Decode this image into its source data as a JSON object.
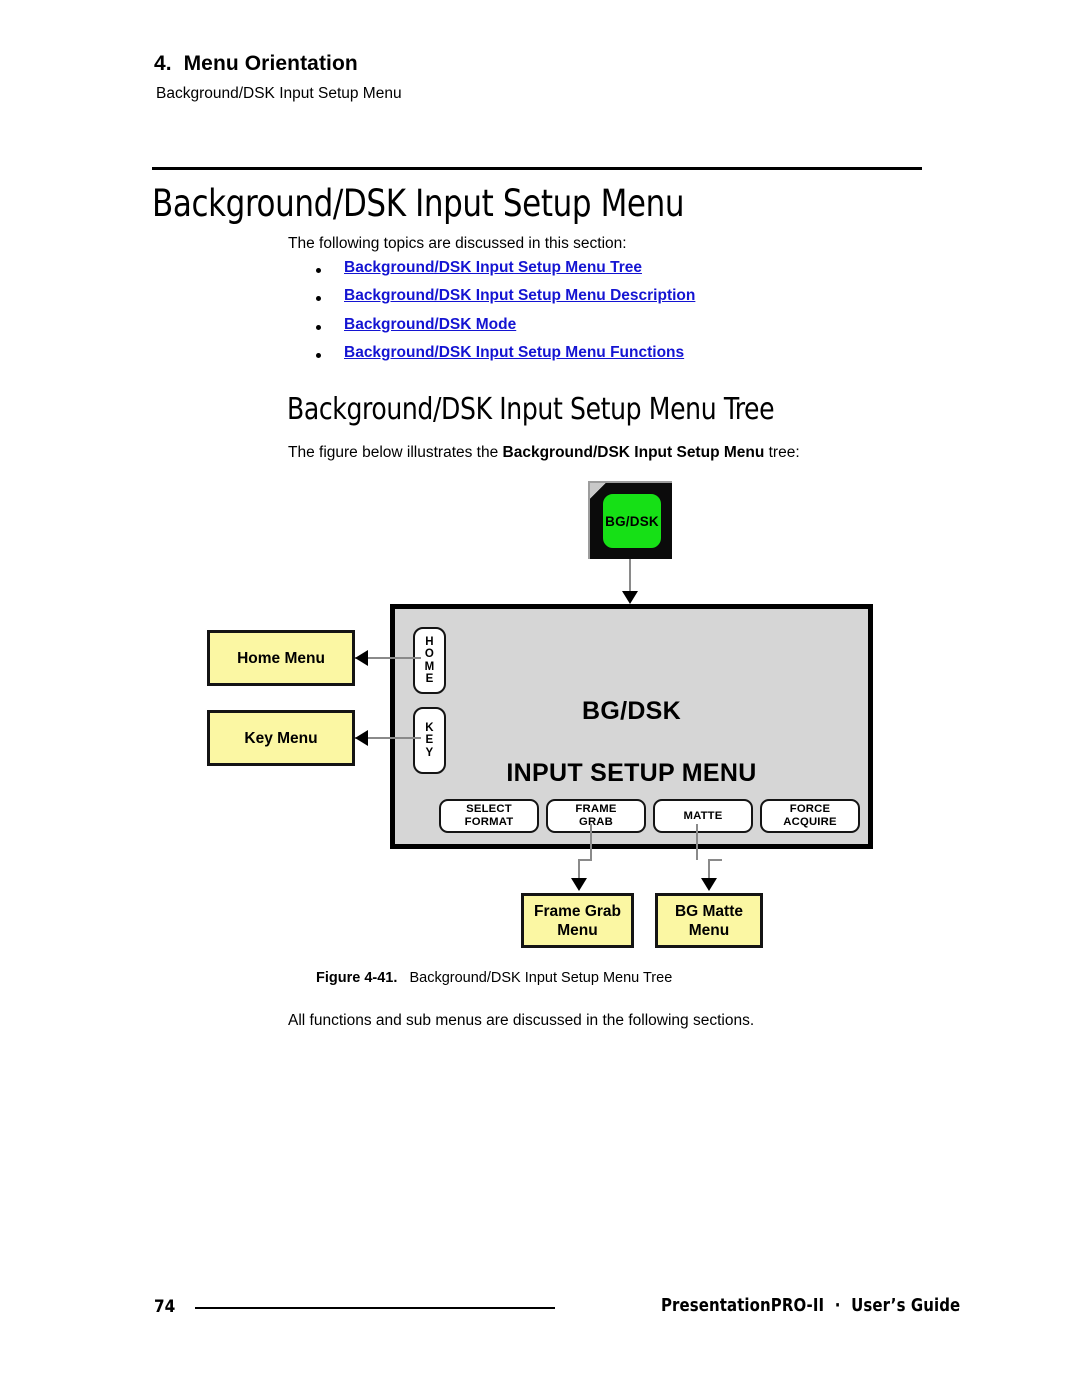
{
  "header": {
    "chapter": "4.  Menu Orientation",
    "subtitle": "Background/DSK Input Setup Menu"
  },
  "main_title": "Background/DSK Input Setup Menu",
  "intro_paragraph": "The following topics are discussed in this section:",
  "topic_links": [
    "Background/DSK Input Setup Menu Tree",
    "Background/DSK Input Setup Menu Description",
    "Background/DSK Mode",
    "Background/DSK Input Setup Menu Functions"
  ],
  "section": {
    "heading": "Background/DSK Input Setup Menu Tree",
    "figure_intro_pre": "The figure below illustrates the ",
    "figure_intro_bold": "Background/DSK Input Setup Menu",
    "figure_intro_post": " tree:"
  },
  "figure": {
    "caption_label": "Figure 4-41.",
    "caption_text": "Background/DSK Input Setup Menu Tree",
    "hardware_button": {
      "label": "BG/DSK",
      "face_color": "#16e016"
    },
    "panel": {
      "title_line1": "BG/DSK",
      "title_line2": "INPUT SETUP MENU",
      "background_color": "#d6d6d6",
      "side_buttons": [
        {
          "name": "home",
          "label": "H\nO\nM\nE"
        },
        {
          "name": "key",
          "label": "K\nE\nY"
        }
      ],
      "function_buttons": [
        {
          "name": "select-format",
          "label": "SELECT\nFORMAT"
        },
        {
          "name": "frame-grab",
          "label": "FRAME\nGRAB"
        },
        {
          "name": "matte",
          "label": "MATTE"
        },
        {
          "name": "force-acquire",
          "label": "FORCE\nACQUIRE"
        }
      ]
    },
    "menu_boxes": [
      {
        "name": "home-menu",
        "label": "Home Menu"
      },
      {
        "name": "key-menu",
        "label": "Key Menu"
      },
      {
        "name": "frame-grab-menu",
        "label": "Frame Grab\nMenu"
      },
      {
        "name": "bg-matte-menu",
        "label": "BG Matte\nMenu"
      }
    ],
    "box_color": "#fbf7a3"
  },
  "closing_paragraph": "All functions and sub menus are discussed in the following sections.",
  "footer": {
    "page_number": "74",
    "guide_text": "PresentationPRO-II  ·  User’s Guide"
  },
  "colors": {
    "link": "#1414d2",
    "yellow": "#fbf7a3",
    "green": "#16e016",
    "panel_gray": "#d6d6d6"
  }
}
